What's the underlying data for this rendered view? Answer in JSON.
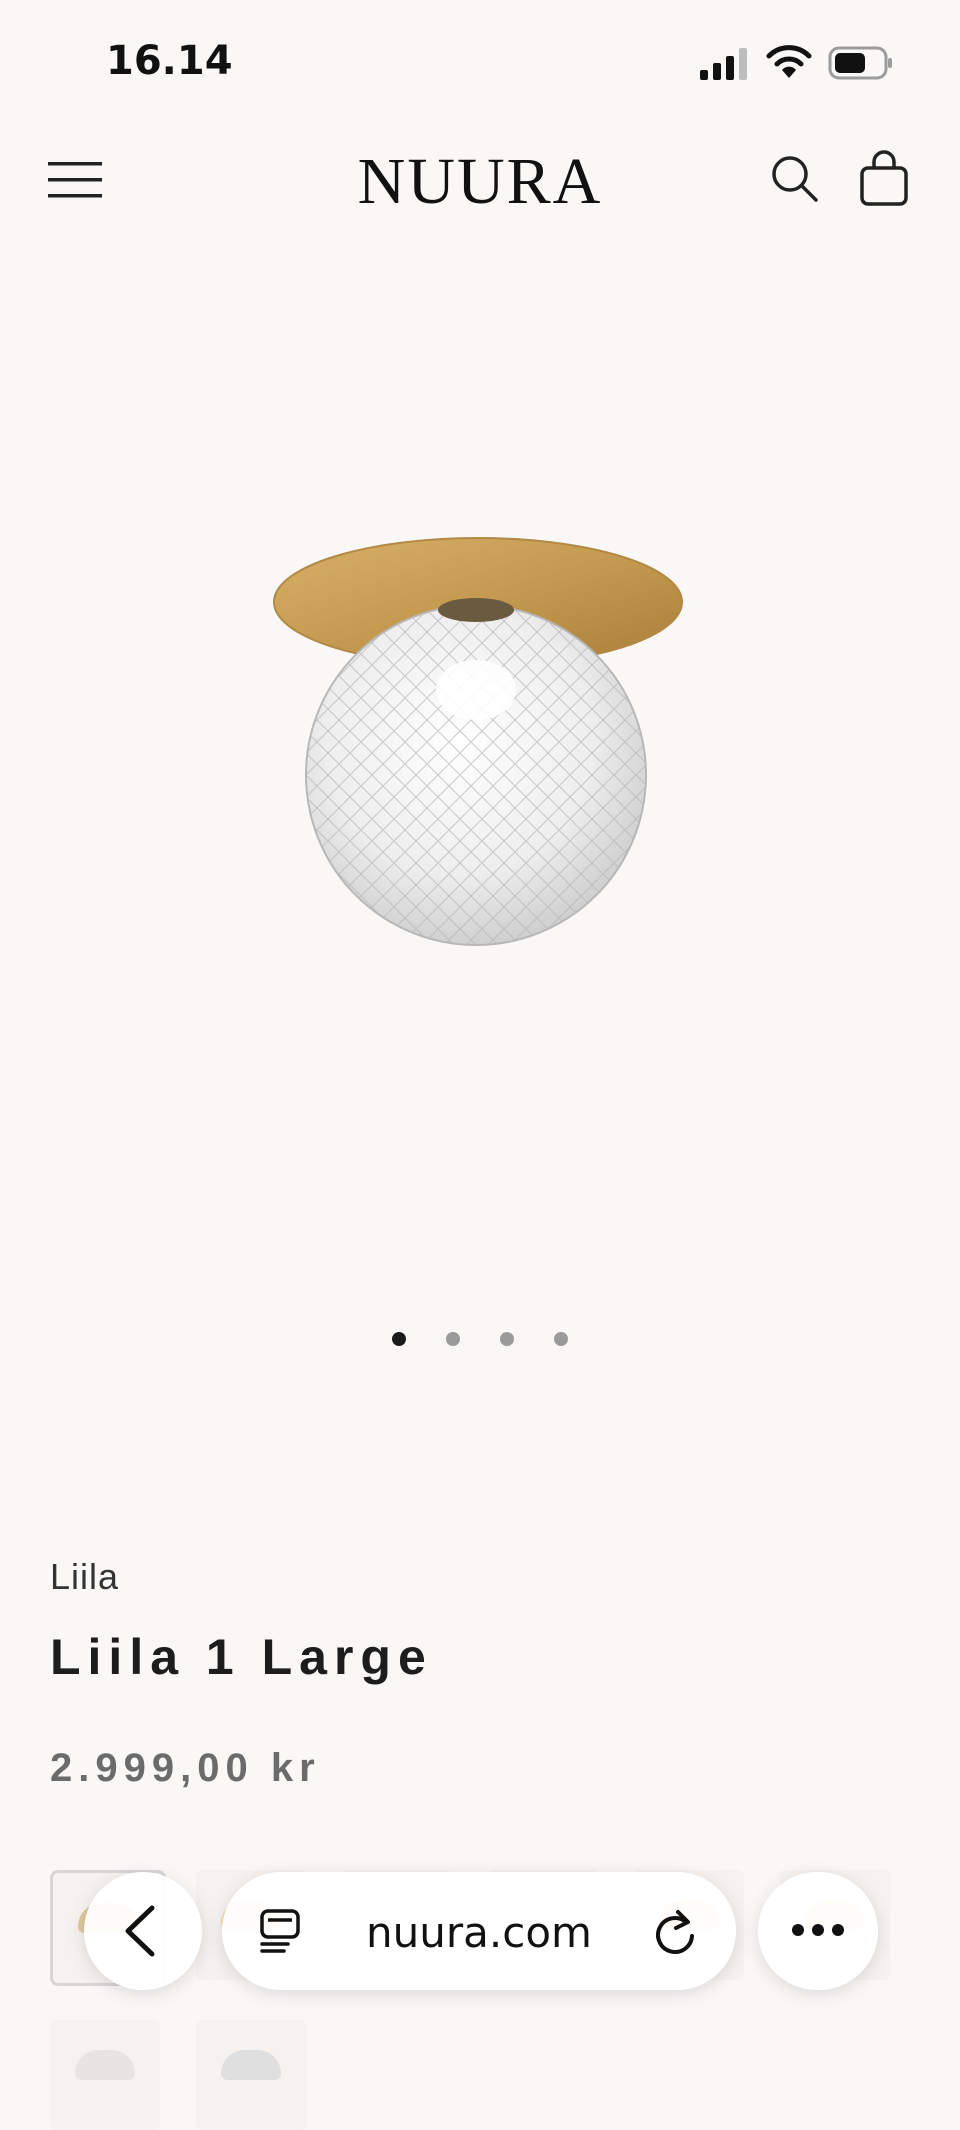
{
  "status_bar": {
    "time": "16.14",
    "icons": [
      "signal-icon",
      "wifi-icon",
      "battery-icon"
    ]
  },
  "header": {
    "brand": "NUURA",
    "icons": [
      "menu-icon",
      "search-icon",
      "bag-icon"
    ]
  },
  "gallery": {
    "image": "ceiling-lamp-photo",
    "slide_count": 4,
    "active_slide": 1
  },
  "product": {
    "collection": "Liila",
    "title": "Liila 1 Large",
    "price": "2.999,00 kr"
  },
  "browser": {
    "url": "nuura.com",
    "icons": [
      "back-chevron-icon",
      "tabs-icon",
      "reload-icon",
      "more-icon"
    ]
  },
  "colors": {
    "background": "#faf8f7",
    "brass": "#caa055",
    "text": "#1a1a1a",
    "price": "#6b6b6b"
  }
}
